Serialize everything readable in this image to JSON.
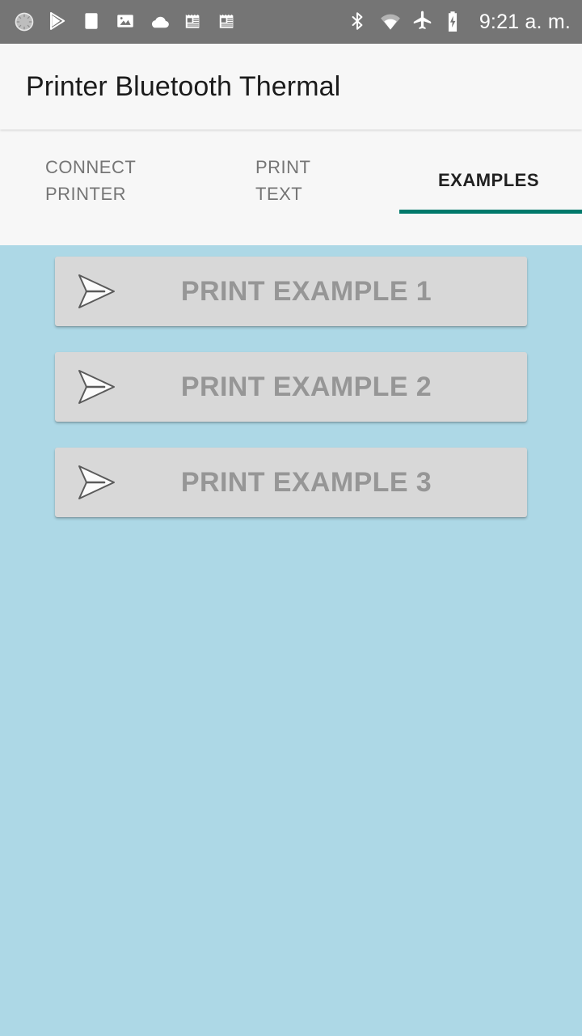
{
  "status_bar": {
    "background": "#757575",
    "time": "9:21 a. m.",
    "left_icons": [
      {
        "name": "sync-progress-icon",
        "label": "sync"
      },
      {
        "name": "play-store-icon",
        "label": "play-store"
      },
      {
        "name": "white-square-icon",
        "label": "app-notification"
      },
      {
        "name": "image-icon",
        "label": "screenshot"
      },
      {
        "name": "cloud-icon",
        "label": "cloud"
      },
      {
        "name": "receipt-icon-1",
        "label": "receipt"
      },
      {
        "name": "receipt-icon-2",
        "label": "receipt"
      }
    ],
    "right_icons": [
      {
        "name": "bluetooth-icon",
        "label": "bluetooth"
      },
      {
        "name": "wifi-icon",
        "label": "wifi"
      },
      {
        "name": "airplane-mode-icon",
        "label": "airplane mode"
      },
      {
        "name": "battery-charging-icon",
        "label": "battery charging"
      }
    ]
  },
  "app_bar": {
    "title": "Printer Bluetooth Thermal",
    "background": "#f7f7f7",
    "title_color": "#1b1b1b"
  },
  "tabs": {
    "indicator_color": "#00796b",
    "inactive_color": "#757575",
    "active_color": "#212121",
    "active_index": 2,
    "items": [
      {
        "label": "CONNECT\nPRINTER",
        "name": "tab-connect-printer",
        "active": false
      },
      {
        "label": "PRINT\nTEXT",
        "name": "tab-print-text",
        "active": false
      },
      {
        "label": "EXAMPLES",
        "name": "tab-examples",
        "active": true
      }
    ]
  },
  "content": {
    "background": "#add8e6",
    "buttons": [
      {
        "label": "PRINT EXAMPLE 1",
        "name": "print-example-1-button",
        "icon": "send-icon"
      },
      {
        "label": "PRINT EXAMPLE 2",
        "name": "print-example-2-button",
        "icon": "send-icon"
      },
      {
        "label": "PRINT EXAMPLE 3",
        "name": "print-example-3-button",
        "icon": "send-icon"
      }
    ],
    "button_background": "#d8d8d8",
    "button_text_color": "#969696"
  }
}
